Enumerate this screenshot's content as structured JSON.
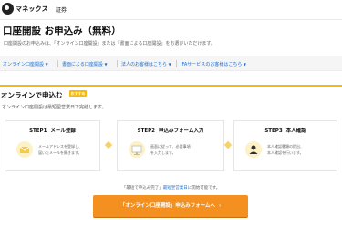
{
  "header": {
    "brand": "マネックス",
    "brand_sub": "証券",
    "logo_icon": "monex-logo-icon"
  },
  "page": {
    "title": "口座開設 お申込み（無料）",
    "intro": "口座開設のお申込みは、「オンライン口座開設」または「書面による口座開設」をお選びいただけます。"
  },
  "nav": {
    "items": [
      {
        "label": "オンライン口座開設"
      },
      {
        "label": "書面による口座開設"
      },
      {
        "label": "法人のお客様はこちら"
      },
      {
        "label": "IFAサービスのお客様はこちら"
      }
    ],
    "arrow": "▼"
  },
  "section": {
    "title": "オンラインで申込む",
    "badge": "おすすめ",
    "description": "オンライン口座開設は最短翌営業日で完結します。"
  },
  "steps": [
    {
      "step": "STEP1",
      "title": "メール登録",
      "text1": "メールアドレスを登録し、",
      "text2": "届いたメールを開きます。",
      "icon": "envelope-icon"
    },
    {
      "step": "STEP2",
      "title": "申込みフォーム入力",
      "text1": "画面に従って、必要事項",
      "text2": "を入力します。",
      "icon": "monitor-icon"
    },
    {
      "step": "STEP3",
      "title": "本人確認",
      "text1": "本人確認書類の提出、",
      "text2": "本人確認を行います。",
      "icon": "person-icon"
    }
  ],
  "note": {
    "prefix": "「最短で申込み完了」",
    "link": "最短翌営業日",
    "suffix": "に開始可能です。"
  },
  "cta": {
    "label": "「オンライン口座開設」申込みフォームへ",
    "arrow": "›"
  },
  "colors": {
    "accent": "#f6b80a",
    "cta": "#f39020",
    "link": "#1a6fd6"
  }
}
